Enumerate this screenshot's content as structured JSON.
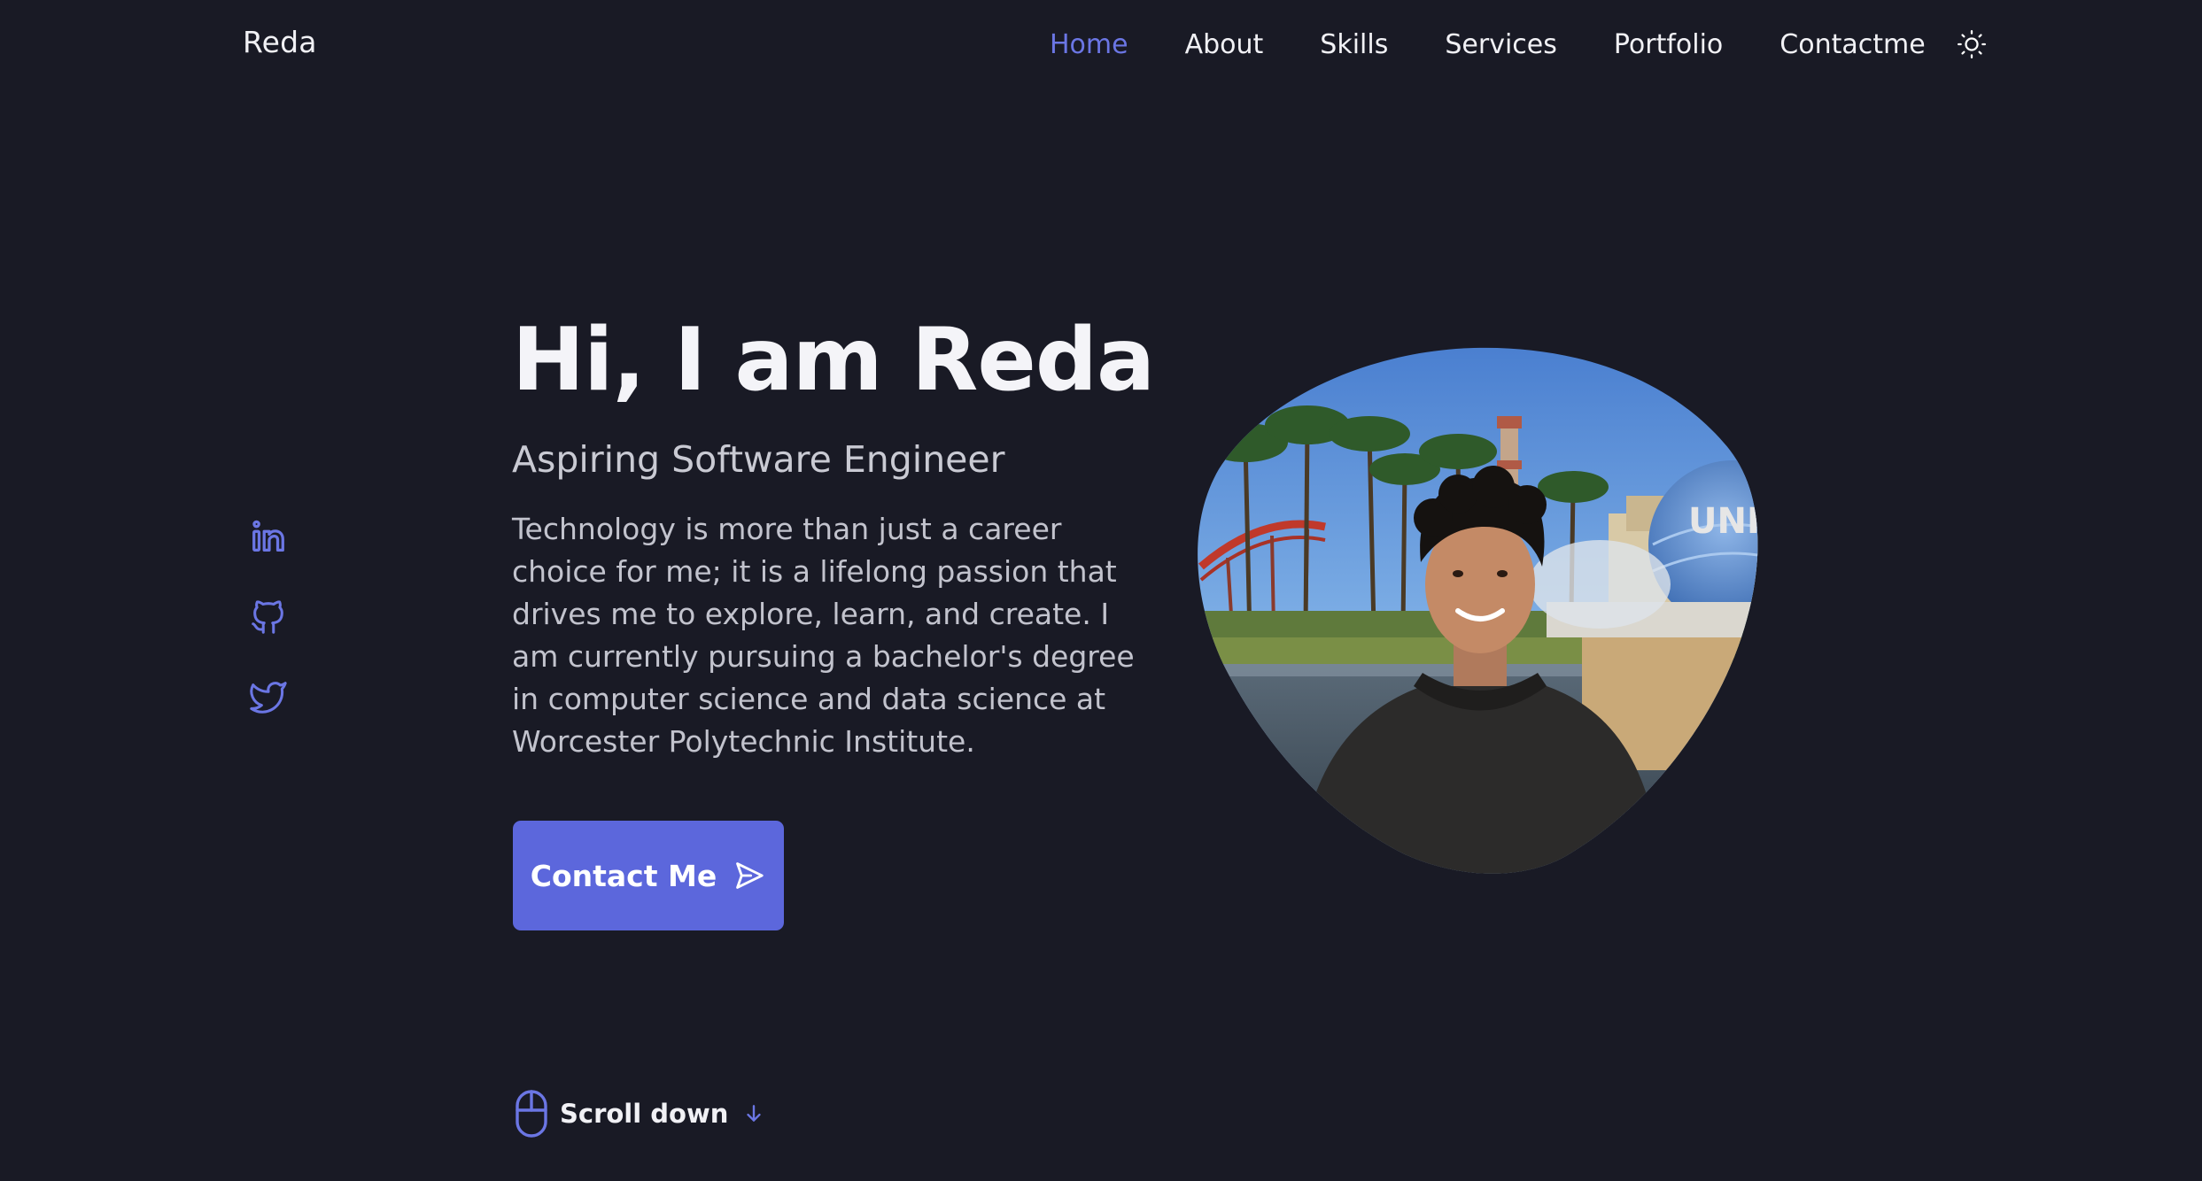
{
  "header": {
    "logo": "Reda",
    "nav": [
      {
        "label": "Home",
        "active": true
      },
      {
        "label": "About",
        "active": false
      },
      {
        "label": "Skills",
        "active": false
      },
      {
        "label": "Services",
        "active": false
      },
      {
        "label": "Portfolio",
        "active": false
      },
      {
        "label": "Contactme",
        "active": false
      }
    ],
    "theme_toggle_icon": "sun-icon"
  },
  "social": [
    {
      "icon": "linkedin-icon"
    },
    {
      "icon": "github-icon"
    },
    {
      "icon": "twitter-icon"
    }
  ],
  "hero": {
    "title": "Hi, I am Reda",
    "subtitle": "Aspiring Software Engineer",
    "description": "Technology is more than just a career choice for me; it is a lifelong passion that drives me to explore, learn, and create. I am currently pursuing a bachelor's degree in computer science and data science at Worcester Polytechnic Institute.",
    "contact_button": "Contact Me",
    "contact_icon": "send-icon",
    "scroll_label": "Scroll down",
    "scroll_icons": [
      "mouse-icon",
      "arrow-down-icon"
    ]
  },
  "photo": {
    "sign_text": "UNIV"
  },
  "colors": {
    "background": "#191a25",
    "accent": "#5c67dc",
    "active_nav": "#6b76e4",
    "text": "#f1f1f5",
    "muted_text": "#c2c3cd"
  }
}
